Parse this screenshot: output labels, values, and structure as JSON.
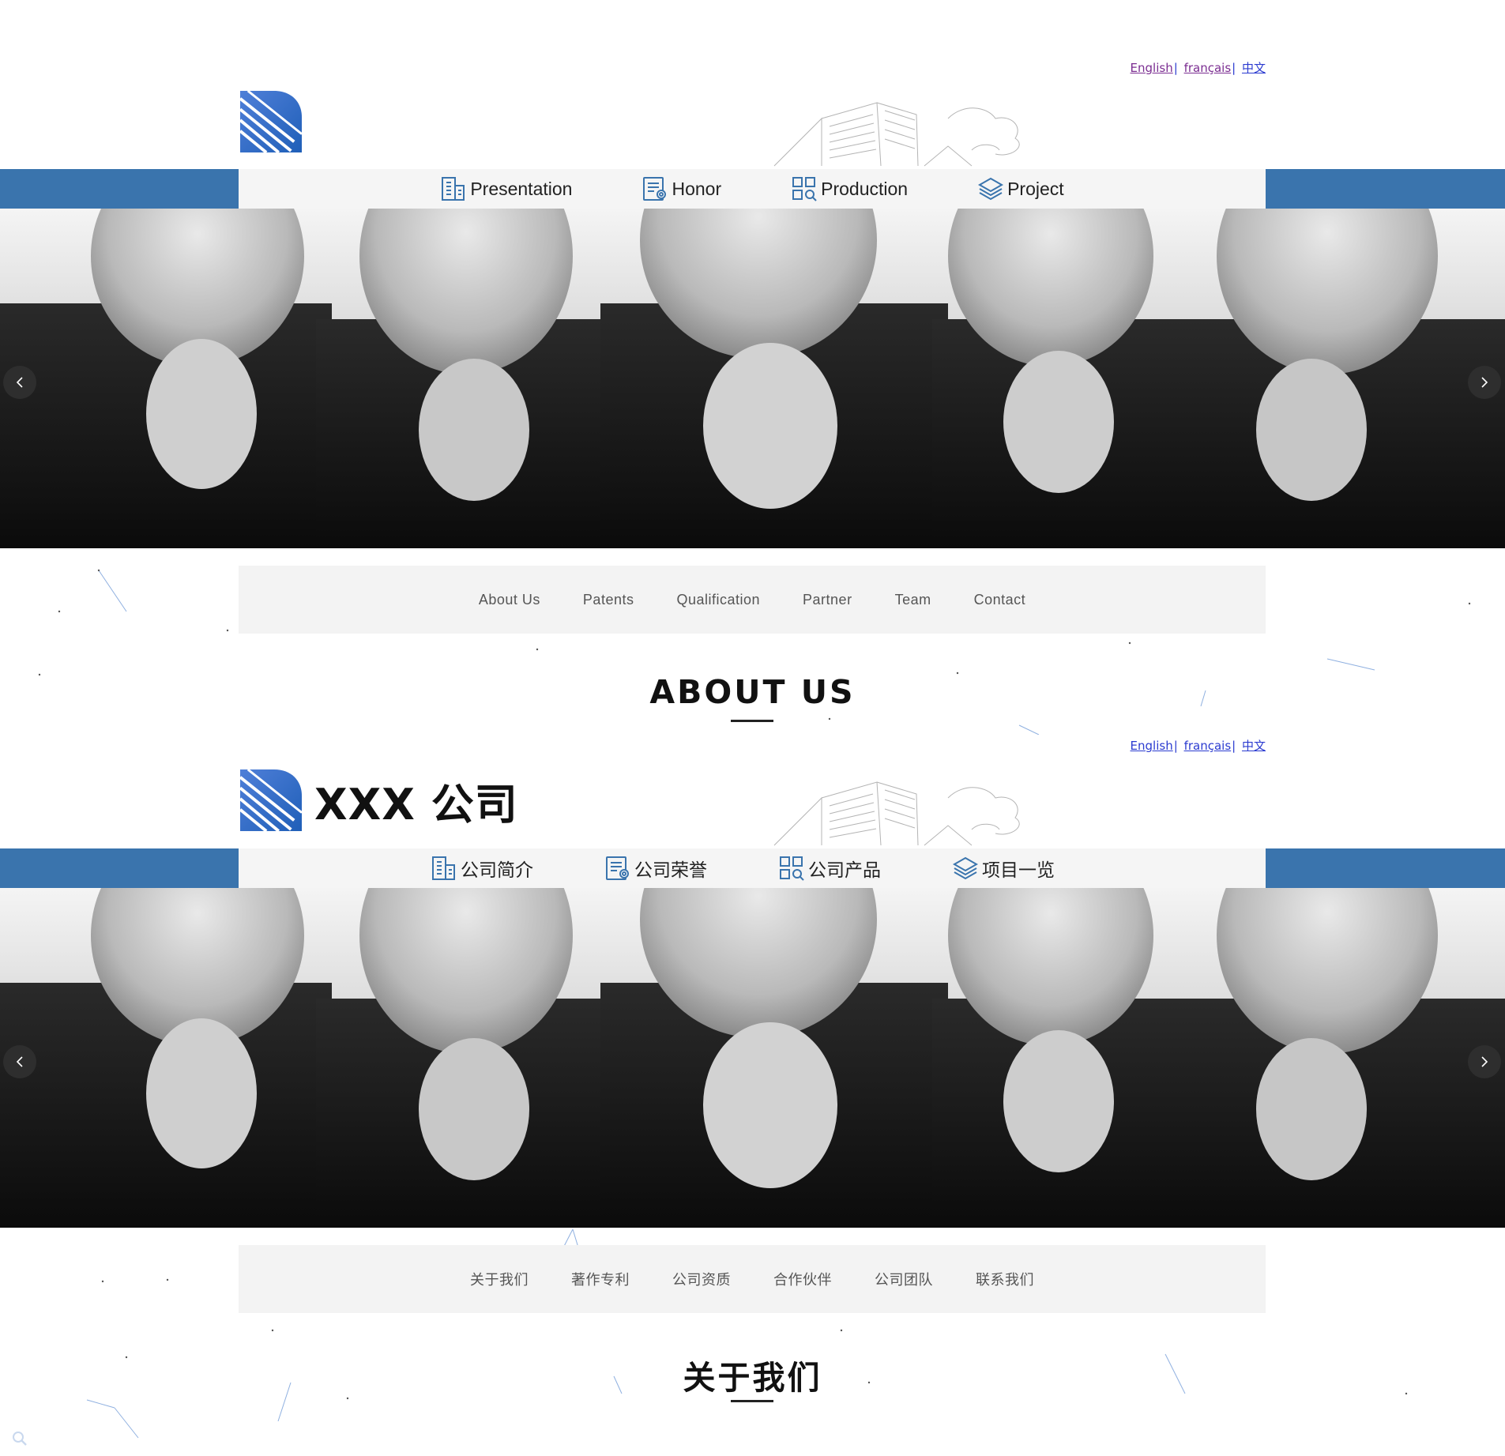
{
  "lang_links": {
    "english": "English",
    "francais": "français",
    "chinese": "中文",
    "sep": "|"
  },
  "colors": {
    "accent": "#3a74ad",
    "nav_bg": "#f5f5f5",
    "subnav_bg": "#f3f3f3"
  },
  "en": {
    "nav": [
      {
        "label": "Presentation",
        "icon": "building-icon"
      },
      {
        "label": "Honor",
        "icon": "certificate-icon"
      },
      {
        "label": "Production",
        "icon": "grid-search-icon"
      },
      {
        "label": "Project",
        "icon": "layers-icon"
      }
    ],
    "subnav": [
      "About Us",
      "Patents",
      "Qualification",
      "Partner",
      "Team",
      "Contact"
    ],
    "heading": "ABOUT US"
  },
  "zh": {
    "brand": "XXX 公司",
    "nav": [
      {
        "label": "公司简介",
        "icon": "building-icon"
      },
      {
        "label": "公司荣誉",
        "icon": "certificate-icon"
      },
      {
        "label": "公司产品",
        "icon": "grid-search-icon"
      },
      {
        "label": "项目一览",
        "icon": "layers-icon"
      }
    ],
    "subnav": [
      "关于我们",
      "著作专利",
      "公司资质",
      "合作伙伴",
      "公司团队",
      "联系我们"
    ],
    "heading": "关于我们"
  }
}
